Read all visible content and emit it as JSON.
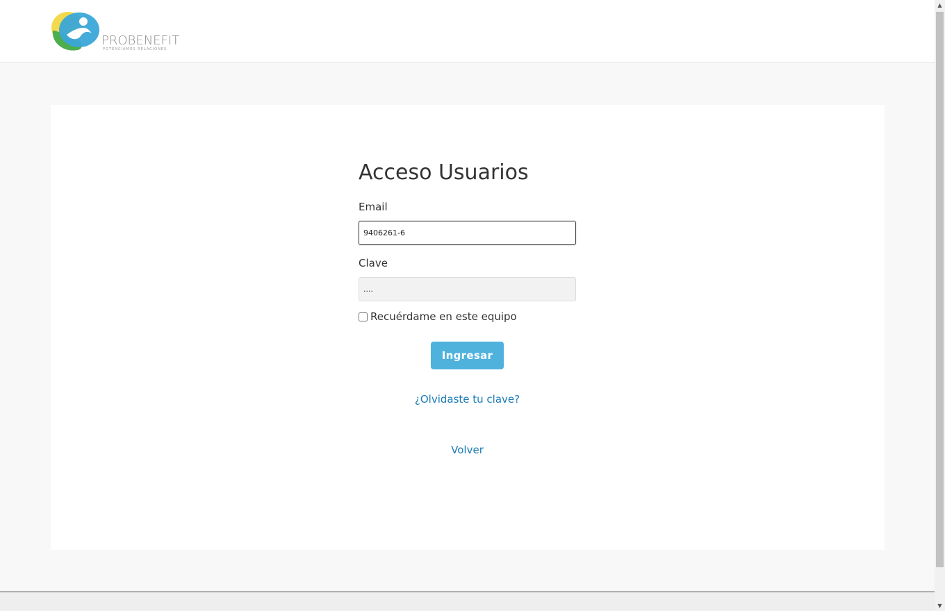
{
  "brand": {
    "name": "PROBENEFIT",
    "tagline": "POTENCIAMOS RELACIONES",
    "colors": {
      "yellow": "#f2d94e",
      "blue": "#3aa6d8",
      "green": "#4cae4c",
      "accent": "#4fb2dd",
      "link": "#1a7bb5"
    }
  },
  "login": {
    "title": "Acceso Usuarios",
    "email_label": "Email",
    "email_value": "9406261-6",
    "password_label": "Clave",
    "password_value": "....",
    "remember_label": "Recuérdame en este equipo",
    "remember_checked": false,
    "submit_label": "Ingresar",
    "forgot_label": "¿Olvidaste tu clave?",
    "back_label": "Volver"
  },
  "icons": {
    "scroll_up": "scroll-up-arrow-icon",
    "scroll_down": "scroll-down-arrow-icon"
  }
}
